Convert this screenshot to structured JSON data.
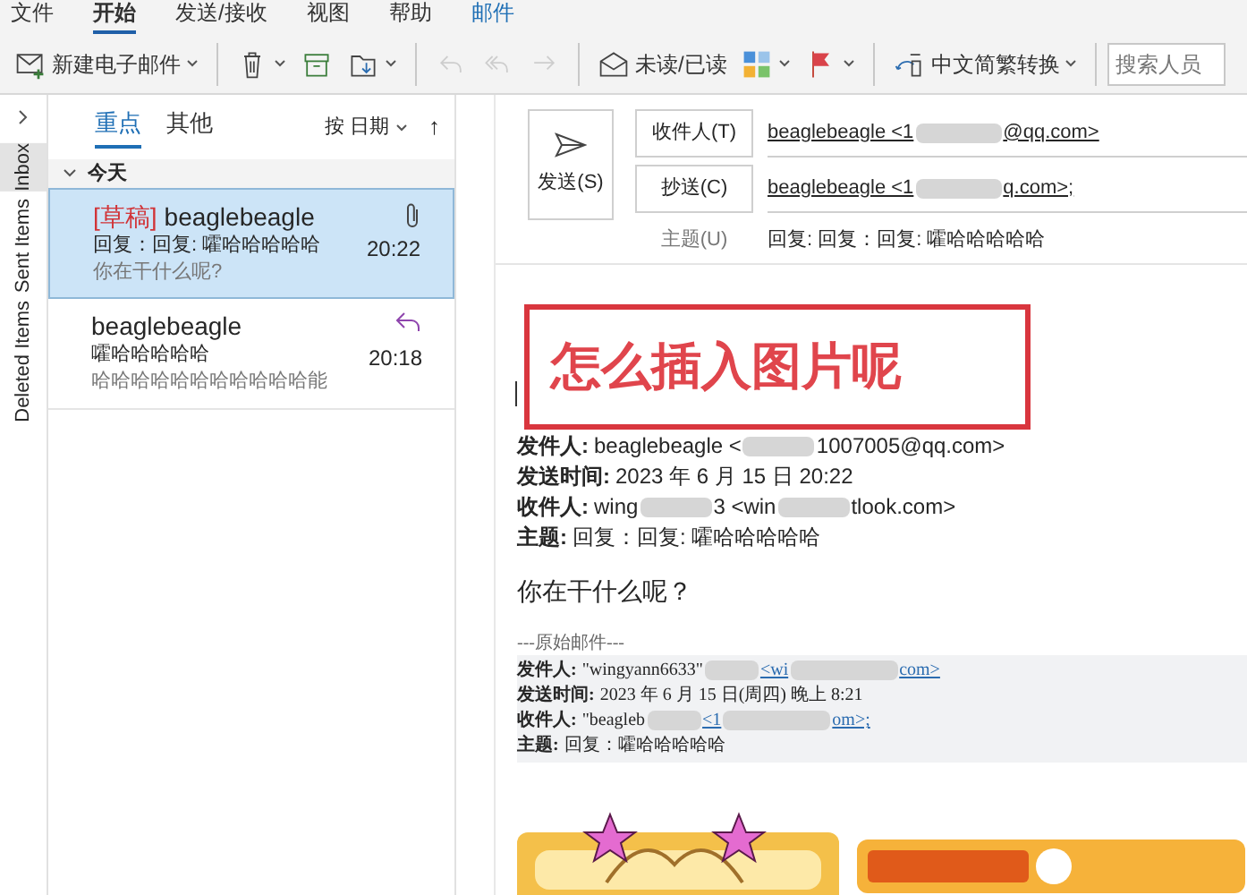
{
  "menu": [
    {
      "label": "文件",
      "selected": false,
      "kind": "plain"
    },
    {
      "label": "开始",
      "selected": true,
      "kind": "plain"
    },
    {
      "label": "发送/接收",
      "selected": false,
      "kind": "plain"
    },
    {
      "label": "视图",
      "selected": false,
      "kind": "plain"
    },
    {
      "label": "帮助",
      "selected": false,
      "kind": "plain"
    },
    {
      "label": "邮件",
      "selected": false,
      "kind": "contextual"
    }
  ],
  "toolbar": [
    {
      "kind": "button",
      "label": "新建电子邮件",
      "caret": true,
      "disabled": false
    },
    {
      "kind": "separator"
    },
    {
      "kind": "button",
      "caret": true,
      "disabled": false
    },
    {
      "kind": "button",
      "caret": false,
      "disabled": false
    },
    {
      "kind": "button",
      "caret": true,
      "disabled": false
    },
    {
      "kind": "separator"
    },
    {
      "kind": "button",
      "caret": false,
      "disabled": true
    },
    {
      "kind": "button",
      "caret": false,
      "disabled": true
    },
    {
      "kind": "button",
      "caret": false,
      "disabled": true
    },
    {
      "kind": "separator"
    },
    {
      "kind": "button",
      "label": "未读/已读",
      "caret": false,
      "disabled": false
    },
    {
      "kind": "button",
      "caret": true,
      "disabled": false
    },
    {
      "kind": "button",
      "caret": true,
      "disabled": false
    },
    {
      "kind": "separator"
    },
    {
      "kind": "button",
      "label": "中文简繁转换",
      "caret": true,
      "disabled": false
    },
    {
      "kind": "separator"
    },
    {
      "kind": "search",
      "placeholder": "搜索人员"
    }
  ],
  "rail": {
    "items": [
      {
        "label": "Inbox",
        "selected": true
      },
      {
        "label": "Sent Items",
        "selected": false
      },
      {
        "label": "Deleted Items",
        "selected": false
      }
    ]
  },
  "list": {
    "tabs": [
      {
        "label": "重点",
        "selected": true
      },
      {
        "label": "其他",
        "selected": false
      }
    ],
    "sort": "按 日期",
    "sort_direction": "↑",
    "group": "今天",
    "messages": [
      {
        "draft_tag": "[草稿]",
        "sender": "beaglebeagle",
        "subject": "回复：回复: 嚯哈哈哈哈哈",
        "preview": "你在干什么呢?",
        "time": "20:22",
        "attachment": true,
        "replied": false,
        "selected": true
      },
      {
        "sender": "beaglebeagle",
        "subject": "嚯哈哈哈哈哈",
        "preview": "哈哈哈哈哈哈哈哈哈哈哈能",
        "time": "20:18",
        "attachment": false,
        "replied": true,
        "selected": false
      }
    ]
  },
  "compose": {
    "send": "发送(S)",
    "fields": [
      {
        "label": "收件人(T)",
        "parts": [
          "beaglebeagle <1",
          "@qq.com>"
        ]
      },
      {
        "label": "抄送(C)",
        "parts": [
          "beaglebeagle <1",
          "q.com>;"
        ]
      }
    ],
    "subject_label": "主题(U)",
    "subject": "回复: 回复：回复: 嚯哈哈哈哈哈",
    "annotation": "怎么插入图片呢",
    "headers": [
      {
        "label": "发件人:",
        "parts": [
          "beaglebeagle <",
          "1007005@qq.com>"
        ]
      },
      {
        "label": "发送时间:",
        "parts": [
          "2023 年 6 月 15 日 20:22"
        ]
      },
      {
        "label": "收件人:",
        "parts": [
          "wing",
          "3 <win",
          "tlook.com>"
        ]
      },
      {
        "label": "主题:",
        "parts": [
          "回复：回复: 嚯哈哈哈哈哈"
        ]
      }
    ],
    "body": "你在干什么呢？",
    "original_marker": "---原始邮件---",
    "original": [
      {
        "label": "发件人:",
        "parts": [
          "\"wingyann6633\"",
          "<wi",
          "com>"
        ]
      },
      {
        "label": "发送时间:",
        "parts": [
          "2023 年 6 月 15 日(周四) 晚上 8:21"
        ]
      },
      {
        "label": "收件人:",
        "parts": [
          "\"beagleb",
          "<1",
          "om>;"
        ]
      },
      {
        "label": "主题:",
        "parts": [
          "回复：嚯哈哈哈哈哈"
        ]
      }
    ]
  }
}
